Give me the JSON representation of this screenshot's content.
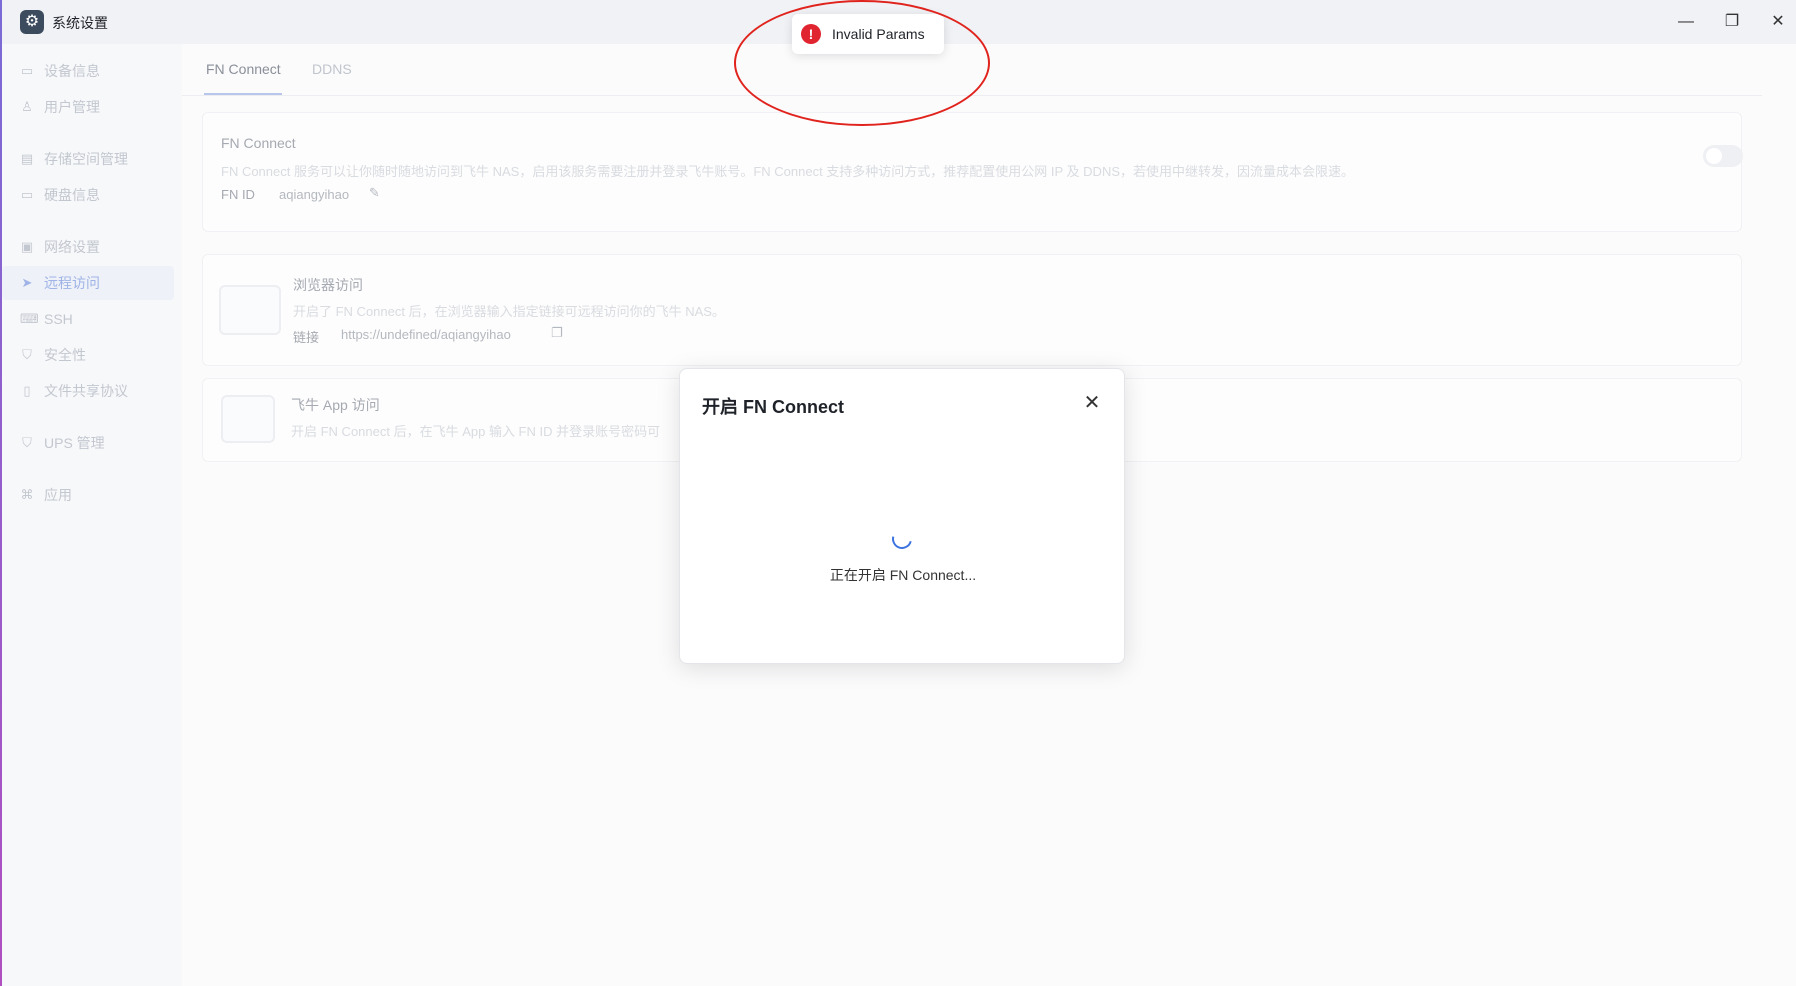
{
  "window": {
    "title": "系统设置",
    "minimize": "—",
    "maximize": "❐",
    "close": "✕"
  },
  "sidebar": {
    "items": [
      {
        "label": "设备信息",
        "icon": "device-icon"
      },
      {
        "label": "用户管理",
        "icon": "user-icon"
      },
      {
        "label": "存储空间管理",
        "icon": "storage-icon"
      },
      {
        "label": "硬盘信息",
        "icon": "disk-icon"
      },
      {
        "label": "网络设置",
        "icon": "network-icon"
      },
      {
        "label": "远程访问",
        "icon": "send-icon",
        "active": true
      },
      {
        "label": "SSH",
        "icon": "terminal-icon"
      },
      {
        "label": "安全性",
        "icon": "shield-icon"
      },
      {
        "label": "文件共享协议",
        "icon": "file-icon"
      },
      {
        "label": "UPS 管理",
        "icon": "ups-shield-icon"
      },
      {
        "label": "应用",
        "icon": "apps-icon"
      }
    ]
  },
  "tabs": [
    {
      "label": "FN Connect",
      "active": true
    },
    {
      "label": "DDNS"
    }
  ],
  "fn_connect_card": {
    "title": "FN Connect",
    "description": "FN Connect 服务可以让你随时随地访问到飞牛 NAS，启用该服务需要注册并登录飞牛账号。FN Connect 支持多种访问方式，推荐配置使用公网 IP 及 DDNS，若使用中继转发，因流量成本会限速。",
    "id_label": "FN ID",
    "id_value": "aqiangyihao",
    "enabled": false
  },
  "browser_card": {
    "title": "浏览器访问",
    "description": "开启了 FN Connect 后，在浏览器输入指定链接可远程访问你的飞牛 NAS。",
    "link_label": "链接",
    "link_value": "https://undefined/aqiangyihao"
  },
  "app_card": {
    "title": "飞牛 App 访问",
    "description": "开启 FN Connect 后，在飞牛 App 输入 FN ID 并登录账号密码可"
  },
  "dialog": {
    "title": "开启 FN Connect",
    "close": "✕",
    "message": "正在开启 FN Connect..."
  },
  "toast": {
    "icon": "!",
    "message": "Invalid Params"
  },
  "colors": {
    "accent": "#3b73e0",
    "error": "#e02430",
    "annotation": "#e0231c"
  }
}
